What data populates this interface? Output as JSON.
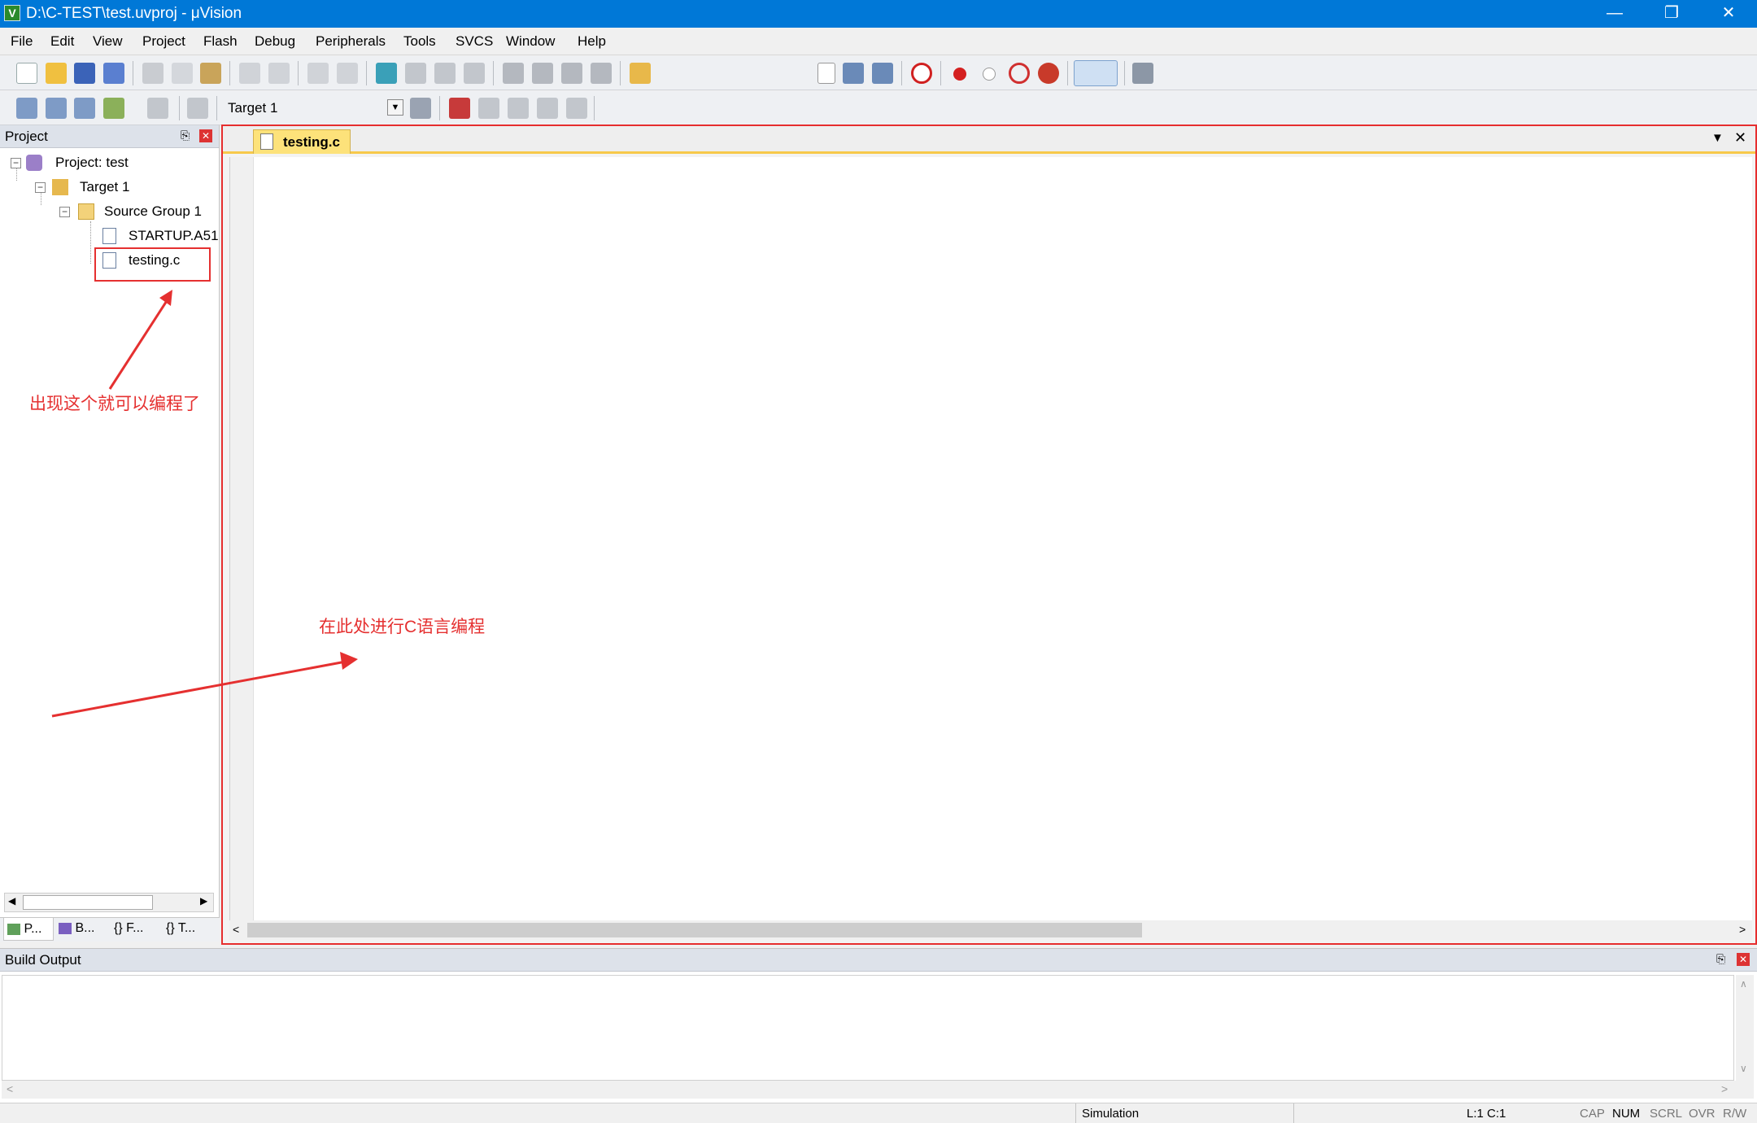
{
  "window": {
    "title": "D:\\C-TEST\\test.uvproj - μVision"
  },
  "menu": [
    "File",
    "Edit",
    "View",
    "Project",
    "Flash",
    "Debug",
    "Peripherals",
    "Tools",
    "SVCS",
    "Window",
    "Help"
  ],
  "build_toolbar": {
    "target_select": "Target 1"
  },
  "project_panel": {
    "title": "Project",
    "tree": {
      "project": "Project: test",
      "target": "Target 1",
      "group": "Source Group 1",
      "files": [
        "STARTUP.A51",
        "testing.c"
      ]
    },
    "bottom_tabs": [
      "P...",
      "B...",
      "F...",
      "T..."
    ]
  },
  "editor": {
    "active_tab": "testing.c"
  },
  "build_output": {
    "title": "Build Output"
  },
  "statusbar": {
    "mode": "Simulation",
    "position": "L:1 C:1",
    "indicators": [
      "CAP",
      "NUM",
      "SCRL",
      "OVR",
      "R/W"
    ]
  },
  "annotations": {
    "file_note": "出现这个就可以编程了",
    "editor_note": "在此处进行C语言编程"
  },
  "colors": {
    "titlebar": "#0078d7",
    "annotation": "#e53030",
    "active_tab": "#fde27a"
  }
}
